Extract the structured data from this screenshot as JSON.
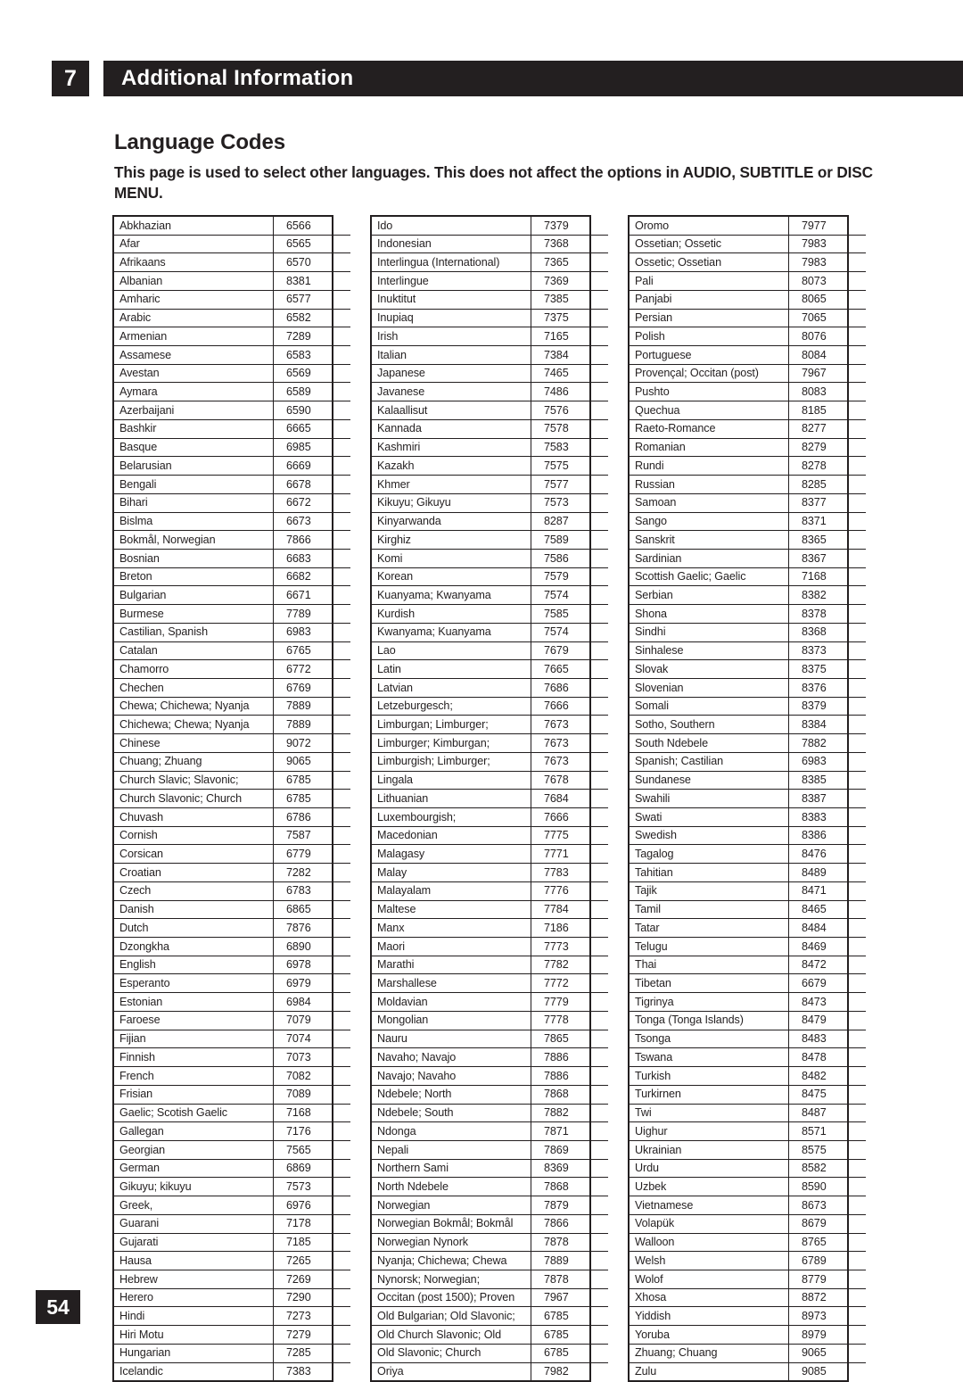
{
  "header": {
    "chapter_number": "7",
    "chapter_title": "Additional Information"
  },
  "section": {
    "title": "Language Codes",
    "intro": "This page is used to select other languages. This does not affect the options in AUDIO, SUBTITLE or DISC MENU."
  },
  "page_number": "54",
  "colors": {
    "ink": "#231f20",
    "paper": "#ffffff"
  },
  "language_table": {
    "columns": [
      {
        "rows": [
          [
            "Abkhazian",
            "6566"
          ],
          [
            "Afar",
            "6565"
          ],
          [
            "Afrikaans",
            "6570"
          ],
          [
            "Albanian",
            "8381"
          ],
          [
            "Amharic",
            "6577"
          ],
          [
            "Arabic",
            "6582"
          ],
          [
            "Armenian",
            "7289"
          ],
          [
            "Assamese",
            "6583"
          ],
          [
            "Avestan",
            "6569"
          ],
          [
            "Aymara",
            "6589"
          ],
          [
            "Azerbaijani",
            "6590"
          ],
          [
            "Bashkir",
            "6665"
          ],
          [
            "Basque",
            "6985"
          ],
          [
            "Belarusian",
            "6669"
          ],
          [
            "Bengali",
            "6678"
          ],
          [
            "Bihari",
            "6672"
          ],
          [
            "Bislma",
            "6673"
          ],
          [
            "Bokmål, Norwegian",
            "7866"
          ],
          [
            "Bosnian",
            "6683"
          ],
          [
            "Breton",
            "6682"
          ],
          [
            "Bulgarian",
            "6671"
          ],
          [
            "Burmese",
            "7789"
          ],
          [
            "Castilian, Spanish",
            "6983"
          ],
          [
            "Catalan",
            "6765"
          ],
          [
            "Chamorro",
            "6772"
          ],
          [
            "Chechen",
            "6769"
          ],
          [
            "Chewa; Chichewa; Nyanja",
            "7889"
          ],
          [
            "Chichewa; Chewa; Nyanja",
            "7889"
          ],
          [
            "Chinese",
            "9072"
          ],
          [
            "Chuang; Zhuang",
            "9065"
          ],
          [
            "Church Slavic; Slavonic;",
            "6785"
          ],
          [
            "Church Slavonic; Church",
            "6785"
          ],
          [
            "Chuvash",
            "6786"
          ],
          [
            "Cornish",
            "7587"
          ],
          [
            "Corsican",
            "6779"
          ],
          [
            "Croatian",
            "7282"
          ],
          [
            "Czech",
            "6783"
          ],
          [
            "Danish",
            "6865"
          ],
          [
            "Dutch",
            "7876"
          ],
          [
            "Dzongkha",
            "6890"
          ],
          [
            "English",
            "6978"
          ],
          [
            "Esperanto",
            "6979"
          ],
          [
            "Estonian",
            "6984"
          ],
          [
            "Faroese",
            "7079"
          ],
          [
            "Fijian",
            "7074"
          ],
          [
            "Finnish",
            "7073"
          ],
          [
            "French",
            "7082"
          ],
          [
            "Frisian",
            "7089"
          ],
          [
            "Gaelic; Scotish Gaelic",
            "7168"
          ],
          [
            "Gallegan",
            "7176"
          ],
          [
            "Georgian",
            "7565"
          ],
          [
            "German",
            "6869"
          ],
          [
            "Gikuyu; kikuyu",
            "7573"
          ],
          [
            "Greek,",
            "6976"
          ],
          [
            "Guarani",
            "7178"
          ],
          [
            "Gujarati",
            "7185"
          ],
          [
            "Hausa",
            "7265"
          ],
          [
            "Hebrew",
            "7269"
          ],
          [
            "Herero",
            "7290"
          ],
          [
            "Hindi",
            "7273"
          ],
          [
            "Hiri Motu",
            "7279"
          ],
          [
            "Hungarian",
            "7285"
          ],
          [
            "Icelandic",
            "7383"
          ]
        ]
      },
      {
        "rows": [
          [
            "Ido",
            "7379"
          ],
          [
            "Indonesian",
            "7368"
          ],
          [
            "Interlingua (International)",
            "7365"
          ],
          [
            "Interlingue",
            "7369"
          ],
          [
            "Inuktitut",
            "7385"
          ],
          [
            "Inupiaq",
            "7375"
          ],
          [
            "Irish",
            "7165"
          ],
          [
            "Italian",
            "7384"
          ],
          [
            "Japanese",
            "7465"
          ],
          [
            "Javanese",
            "7486"
          ],
          [
            "Kalaallisut",
            "7576"
          ],
          [
            "Kannada",
            "7578"
          ],
          [
            "Kashmiri",
            "7583"
          ],
          [
            "Kazakh",
            "7575"
          ],
          [
            "Khmer",
            "7577"
          ],
          [
            "Kikuyu; Gikuyu",
            "7573"
          ],
          [
            "Kinyarwanda",
            "8287"
          ],
          [
            "Kirghiz",
            "7589"
          ],
          [
            "Komi",
            "7586"
          ],
          [
            "Korean",
            "7579"
          ],
          [
            "Kuanyama; Kwanyama",
            "7574"
          ],
          [
            "Kurdish",
            "7585"
          ],
          [
            "Kwanyama; Kuanyama",
            "7574"
          ],
          [
            "Lao",
            "7679"
          ],
          [
            "Latin",
            "7665"
          ],
          [
            "Latvian",
            "7686"
          ],
          [
            "Letzeburgesch;",
            "7666"
          ],
          [
            "Limburgan; Limburger;",
            "7673"
          ],
          [
            "Limburger; Kimburgan;",
            "7673"
          ],
          [
            "Limburgish; Limburger;",
            "7673"
          ],
          [
            "Lingala",
            "7678"
          ],
          [
            "Lithuanian",
            "7684"
          ],
          [
            "Luxembourgish;",
            "7666"
          ],
          [
            "Macedonian",
            "7775"
          ],
          [
            "Malagasy",
            "7771"
          ],
          [
            "Malay",
            "7783"
          ],
          [
            "Malayalam",
            "7776"
          ],
          [
            "Maltese",
            "7784"
          ],
          [
            "Manx",
            "7186"
          ],
          [
            "Maori",
            "7773"
          ],
          [
            "Marathi",
            "7782"
          ],
          [
            "Marshallese",
            "7772"
          ],
          [
            "Moldavian",
            "7779"
          ],
          [
            "Mongolian",
            "7778"
          ],
          [
            "Nauru",
            "7865"
          ],
          [
            "Navaho; Navajo",
            "7886"
          ],
          [
            "Navajo; Navaho",
            "7886"
          ],
          [
            "Ndebele; North",
            "7868"
          ],
          [
            "Ndebele; South",
            "7882"
          ],
          [
            "Ndonga",
            "7871"
          ],
          [
            "Nepali",
            "7869"
          ],
          [
            "Northern Sami",
            "8369"
          ],
          [
            "North Ndebele",
            "7868"
          ],
          [
            "Norwegian",
            "7879"
          ],
          [
            "Norwegian Bokmål; Bokmål",
            "7866"
          ],
          [
            "Norwegian Nynork",
            "7878"
          ],
          [
            "Nyanja; Chichewa; Chewa",
            "7889"
          ],
          [
            "Nynorsk; Norwegian;",
            "7878"
          ],
          [
            "Occitan (post 1500); Proven",
            "7967"
          ],
          [
            "Old Bulgarian; Old Slavonic;",
            "6785"
          ],
          [
            "Old Church Slavonic; Old",
            "6785"
          ],
          [
            "Old Slavonic; Church",
            "6785"
          ],
          [
            "Oriya",
            "7982"
          ]
        ]
      },
      {
        "rows": [
          [
            "Oromo",
            "7977"
          ],
          [
            "Ossetian; Ossetic",
            "7983"
          ],
          [
            "Ossetic; Ossetian",
            "7983"
          ],
          [
            "Pali",
            "8073"
          ],
          [
            "Panjabi",
            "8065"
          ],
          [
            "Persian",
            "7065"
          ],
          [
            "Polish",
            "8076"
          ],
          [
            "Portuguese",
            "8084"
          ],
          [
            "Provençal; Occitan (post)",
            "7967"
          ],
          [
            "Pushto",
            "8083"
          ],
          [
            "Quechua",
            "8185"
          ],
          [
            "Raeto-Romance",
            "8277"
          ],
          [
            "Romanian",
            "8279"
          ],
          [
            "Rundi",
            "8278"
          ],
          [
            "Russian",
            "8285"
          ],
          [
            "Samoan",
            "8377"
          ],
          [
            "Sango",
            "8371"
          ],
          [
            "Sanskrit",
            "8365"
          ],
          [
            "Sardinian",
            "8367"
          ],
          [
            "Scottish Gaelic; Gaelic",
            "7168"
          ],
          [
            "Serbian",
            "8382"
          ],
          [
            "Shona",
            "8378"
          ],
          [
            "Sindhi",
            "8368"
          ],
          [
            "Sinhalese",
            "8373"
          ],
          [
            "Slovak",
            "8375"
          ],
          [
            "Slovenian",
            "8376"
          ],
          [
            "Somali",
            "8379"
          ],
          [
            "Sotho, Southern",
            "8384"
          ],
          [
            "South Ndebele",
            "7882"
          ],
          [
            "Spanish; Castilian",
            "6983"
          ],
          [
            "Sundanese",
            "8385"
          ],
          [
            "Swahili",
            "8387"
          ],
          [
            "Swati",
            "8383"
          ],
          [
            "Swedish",
            "8386"
          ],
          [
            "Tagalog",
            "8476"
          ],
          [
            "Tahitian",
            "8489"
          ],
          [
            "Tajik",
            "8471"
          ],
          [
            "Tamil",
            "8465"
          ],
          [
            "Tatar",
            "8484"
          ],
          [
            "Telugu",
            "8469"
          ],
          [
            "Thai",
            "8472"
          ],
          [
            "Tibetan",
            "6679"
          ],
          [
            "Tigrinya",
            "8473"
          ],
          [
            "Tonga (Tonga Islands)",
            "8479"
          ],
          [
            "Tsonga",
            "8483"
          ],
          [
            "Tswana",
            "8478"
          ],
          [
            "Turkish",
            "8482"
          ],
          [
            "Turkirnen",
            "8475"
          ],
          [
            "Twi",
            "8487"
          ],
          [
            "Uighur",
            "8571"
          ],
          [
            "Ukrainian",
            "8575"
          ],
          [
            "Urdu",
            "8582"
          ],
          [
            "Uzbek",
            "8590"
          ],
          [
            "Vietnamese",
            "8673"
          ],
          [
            "Volapük",
            "8679"
          ],
          [
            "Walloon",
            "8765"
          ],
          [
            "Welsh",
            "6789"
          ],
          [
            "Wolof",
            "8779"
          ],
          [
            "Xhosa",
            "8872"
          ],
          [
            "Yiddish",
            "8973"
          ],
          [
            "Yoruba",
            "8979"
          ],
          [
            "Zhuang; Chuang",
            "9065"
          ],
          [
            "Zulu",
            "9085"
          ]
        ]
      }
    ]
  }
}
